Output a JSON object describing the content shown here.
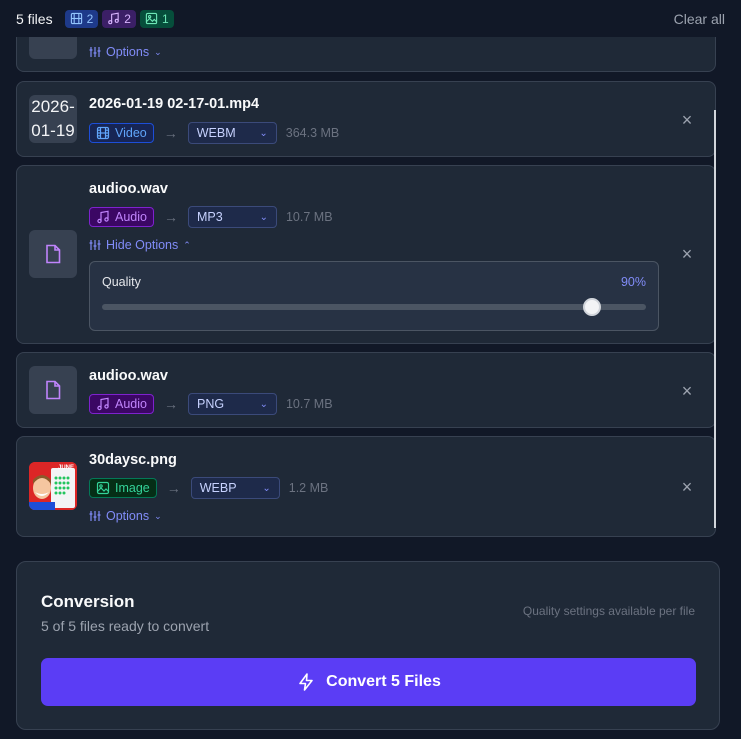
{
  "header": {
    "files_count": "5 files",
    "video_count": "2",
    "audio_count": "2",
    "image_count": "1",
    "clear_all": "Clear all"
  },
  "partial_card": {
    "thumb_text": "file",
    "options_label": "Options"
  },
  "files": [
    {
      "name": "2026-01-19 02-17-01.mp4",
      "thumb_line1": "2026-",
      "thumb_line2": "01-19",
      "type": "Video",
      "format": "WEBM",
      "size": "364.3 MB"
    },
    {
      "name": "audioo.wav",
      "type": "Audio",
      "format": "MP3",
      "size": "10.7 MB",
      "options_label": "Hide Options",
      "quality_label": "Quality",
      "quality_value": "90%",
      "quality_fraction": 0.9
    },
    {
      "name": "audioo.wav",
      "type": "Audio",
      "format": "PNG",
      "size": "10.7 MB"
    },
    {
      "name": "30daysc.png",
      "type": "Image",
      "format": "WEBP",
      "size": "1.2 MB",
      "options_label": "Options",
      "thumb_text": "JUNE"
    }
  ],
  "conversion": {
    "title": "Conversion",
    "subtitle": "5 of 5 files ready to convert",
    "note": "Quality settings available per file",
    "button_label": "Convert 5 Files"
  },
  "colors": {
    "accent": "#5b3df5",
    "video": "#60a5fa",
    "audio": "#c084fc",
    "image": "#34d399"
  }
}
